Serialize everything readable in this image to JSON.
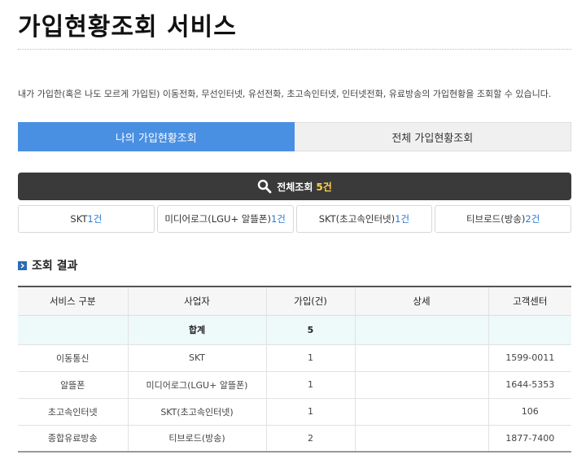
{
  "page": {
    "title": "가입현황조회 서비스",
    "description": "내가 가입한(혹은 나도 모르게 가입된) 이동전화, 무선인터넷, 유선전화, 초고속인터넷, 인터넷전화, 유료방송의 가입현황을 조회할 수 있습니다."
  },
  "tabs": [
    {
      "label": "나의 가입현황조회",
      "active": true
    },
    {
      "label": "전체 가입현황조회",
      "active": false
    }
  ],
  "summary": {
    "label": "전체조회",
    "count": "5건",
    "icon": "search-icon"
  },
  "filters": [
    {
      "name": "SKT",
      "count": "1건"
    },
    {
      "name": "미디어로그(LGU+ 알뜰폰)",
      "count": "1건"
    },
    {
      "name": "SKT(초고속인터넷)",
      "count": "1건"
    },
    {
      "name": "티브로드(방송)",
      "count": "2건"
    }
  ],
  "results": {
    "section_title": "조회 결과",
    "headers": [
      "서비스 구분",
      "사업자",
      "가입(건)",
      "상세",
      "고객센터"
    ],
    "total": {
      "label": "합계",
      "count": "5"
    },
    "rows": [
      {
        "service": "이동통신",
        "provider": "SKT",
        "count": "1",
        "detail": "",
        "center": "1599-0011"
      },
      {
        "service": "알뜰폰",
        "provider": "미디어로그(LGU+ 알뜰폰)",
        "count": "1",
        "detail": "",
        "center": "1644-5353"
      },
      {
        "service": "초고속인터넷",
        "provider": "SKT(초고속인터넷)",
        "count": "1",
        "detail": "",
        "center": "106"
      },
      {
        "service": "종합유료방송",
        "provider": "티브로드(방송)",
        "count": "2",
        "detail": "",
        "center": "1877-7400"
      }
    ]
  },
  "colors": {
    "accent": "#4a90e2",
    "dark_bar": "#3a3a3a",
    "highlight": "#ffd34d",
    "sum_row": "#eefaf9"
  }
}
